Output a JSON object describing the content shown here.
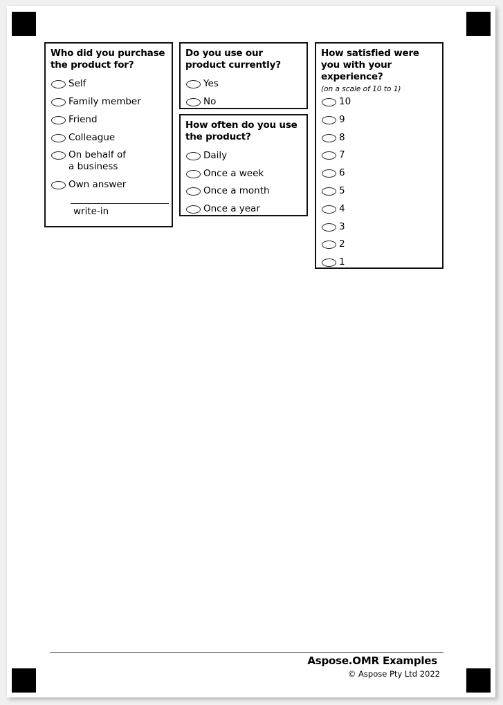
{
  "questions": [
    {
      "title": "Who did you purchase the product for?",
      "options": [
        "Self",
        "Family member",
        "Friend",
        "Colleague",
        "On behalf of a business",
        "Own answer"
      ],
      "write_in_label": "write-in"
    },
    {
      "title": "Do you use our product currently?",
      "options": [
        "Yes",
        "No"
      ]
    },
    {
      "title": "How often do you use the product?",
      "options": [
        "Daily",
        "Once a week",
        "Once a month",
        "Once a year"
      ]
    },
    {
      "title": "How satisfied were you with your experience?",
      "subtitle": "(on a scale of 10 to 1)",
      "options": [
        "10",
        "9",
        "8",
        "7",
        "6",
        "5",
        "4",
        "3",
        "2",
        "1"
      ]
    }
  ],
  "footer": {
    "title": "Aspose.OMR Examples",
    "copyright": "© Aspose Pty Ltd 2022"
  }
}
